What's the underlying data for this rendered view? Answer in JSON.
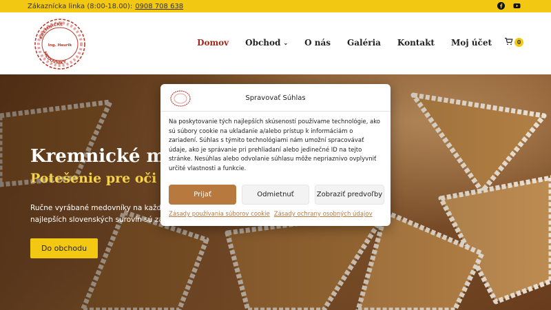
{
  "topbar": {
    "hotline_label": "Zákaznícka linka (8:00-18.00):",
    "phone": "0908 708 638",
    "social": [
      "facebook-icon",
      "youtube-icon"
    ]
  },
  "header": {
    "logo": {
      "top_text": "KREMNICKÉ",
      "middle_text": "Ing. Haurik",
      "bottom_text": "MEDOVNÍKY"
    },
    "nav": {
      "home": "Domov",
      "shop": "Obchod",
      "about": "O nás",
      "gallery": "Galéria",
      "contact": "Kontakt",
      "account": "Moj účet"
    },
    "cart_count": "0"
  },
  "hero": {
    "title": "Kremnické me",
    "subtitle": "Potešenie pre oči aj j",
    "text": "Ručne vyrábané medovníky na každú\nnajlepších slovenských surovín sú zár",
    "button": "Do obchodu"
  },
  "cookie_modal": {
    "title": "Spravovať Súhlas",
    "body": "Na poskytovanie tých najlepších skúseností používame technológie, ako sú súbory cookie na ukladanie a/alebo prístup k informáciám o zariadení. Súhlas s týmito technológiami nám umožní spracovávať údaje, ako je správanie pri prehliadaní alebo jedinečné ID na tejto stránke. Nesúhlas alebo odvolanie súhlasu môže nepriaznivo ovplyvniť určité vlastnosti a funkcie.",
    "accept": "Prijať",
    "deny": "Odmietnuť",
    "preferences": "Zobraziť predvoľby",
    "cookie_policy_link": "Zásady používania súborov cookie",
    "privacy_policy_link": "Zásady ochrany osobných údajov"
  },
  "colors": {
    "accent_yellow": "#f2c812",
    "active_nav": "#a0291b",
    "accept_button": "#b8793f"
  }
}
